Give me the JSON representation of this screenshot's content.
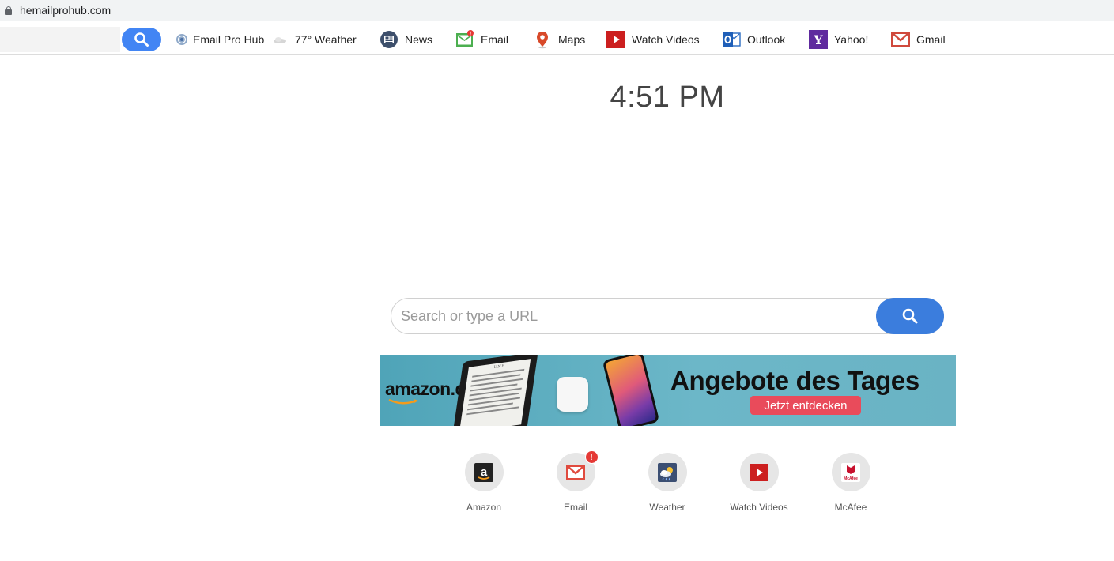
{
  "browser": {
    "url": "hemailprohub.com"
  },
  "toolbar": {
    "items": [
      {
        "label": "Email Pro Hub",
        "icon": "globe-icon"
      },
      {
        "label": "77° Weather",
        "icon": "cloud-icon"
      },
      {
        "label": "News",
        "icon": "news-icon"
      },
      {
        "label": "Email",
        "icon": "email-icon"
      },
      {
        "label": "Maps",
        "icon": "map-pin-icon"
      },
      {
        "label": "Watch Videos",
        "icon": "play-icon"
      },
      {
        "label": "Outlook",
        "icon": "outlook-icon"
      },
      {
        "label": "Yahoo!",
        "icon": "yahoo-icon"
      },
      {
        "label": "Gmail",
        "icon": "gmail-icon"
      }
    ]
  },
  "clock": {
    "time": "4:51 PM"
  },
  "search": {
    "placeholder": "Search or type a URL",
    "value": ""
  },
  "banner": {
    "logo": "amazon.de",
    "kindle_header": "UNE",
    "headline": "Angebote des Tages",
    "cta": "Jetzt entdecken"
  },
  "tiles": [
    {
      "label": "Amazon",
      "icon": "amazon-icon"
    },
    {
      "label": "Email",
      "icon": "email-icon",
      "badge": "!"
    },
    {
      "label": "Weather",
      "icon": "weather-icon"
    },
    {
      "label": "Watch Videos",
      "icon": "play-icon"
    },
    {
      "label": "McAfee",
      "icon": "mcafee-icon",
      "icon_text": "McAfee"
    }
  ],
  "colors": {
    "accent": "#4285f4",
    "search_button": "#3b7ddd",
    "cta": "#e94b5b"
  }
}
